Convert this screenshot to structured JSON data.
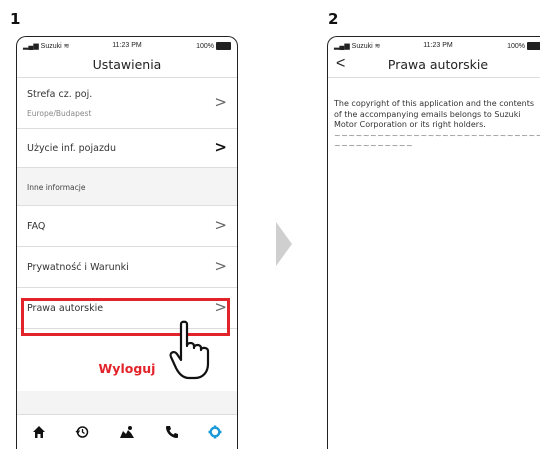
{
  "steps": {
    "first": "1",
    "second": "2"
  },
  "status": {
    "carrier": "Suzuki",
    "time": "11:23 PM",
    "battery": "100%"
  },
  "screen1": {
    "title": "Ustawienia",
    "timezone_label": "Strefa cz. poj.",
    "timezone_value": "Europe/Budapest",
    "vehicle_info_label": "Użycie inf. pojazdu",
    "section_other": "Inne informacje",
    "faq_label": "FAQ",
    "privacy_label": "Prywatność i Warunki",
    "copyright_label": "Prawa autorskie",
    "logout_label": "Wyloguj",
    "tabs": [
      "home-icon",
      "history-icon",
      "map-icon",
      "phone-icon",
      "settings-icon"
    ],
    "active_tab_color": "#1a9ad6",
    "highlight_color": "#e3232a"
  },
  "screen2": {
    "title": "Prawa autorskie",
    "body": "The copyright of this application and the contents of the accompanying emails belongs to Suzuki Motor Corporation or its right holders.",
    "tilde_line1": "~~~~~~~~~~~~~~~~~~~~~~~~~~~~~~~~~~~~",
    "tilde_line2": "~~~~~~~~~~~"
  }
}
